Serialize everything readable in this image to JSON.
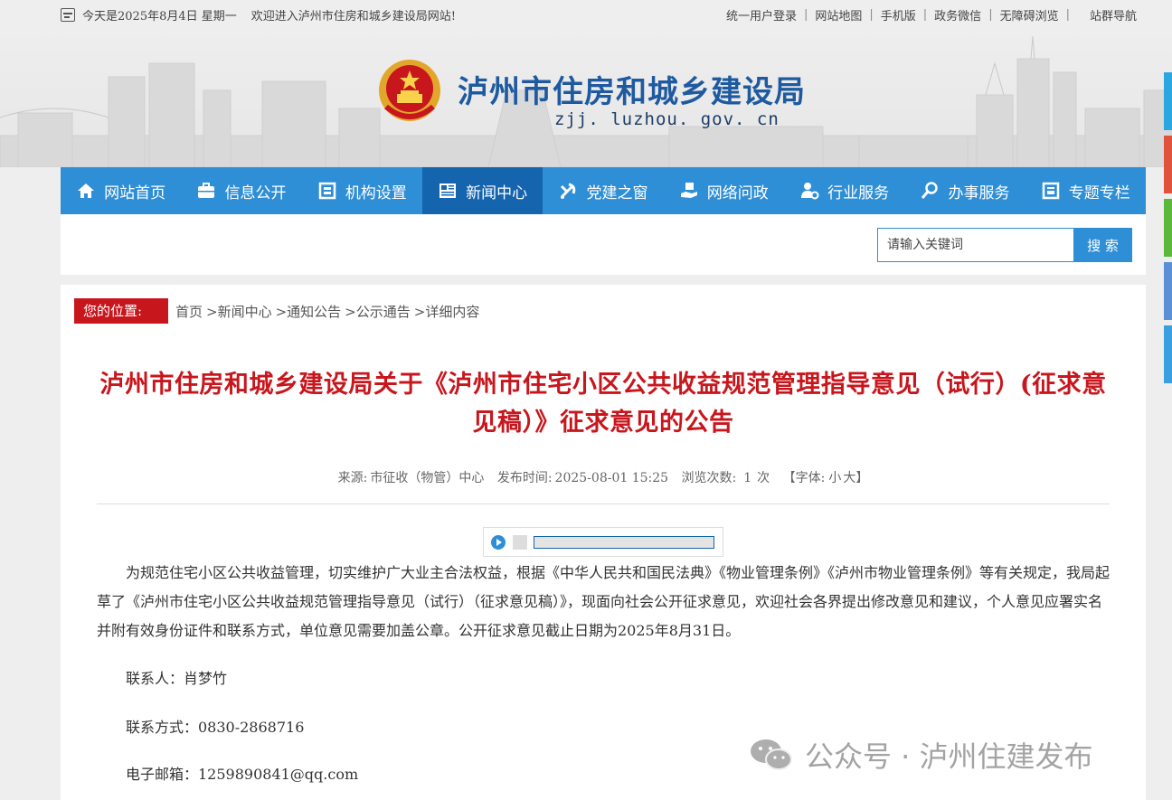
{
  "topbar": {
    "date_text": "今天是2025年8月4日 星期一",
    "welcome": "欢迎进入泸州市住房和城乡建设局网站!",
    "links": [
      "统一用户登录",
      "网站地图",
      "手机版",
      "政务微信",
      "无障碍浏览"
    ],
    "site_nav": "站群导航"
  },
  "header": {
    "title": "泸州市住房和城乡建设局",
    "domain": "zjj. luzhou. gov. cn",
    "emblem_icon": "national-emblem-icon"
  },
  "nav": {
    "items": [
      {
        "label": "网站首页",
        "icon": "home-icon"
      },
      {
        "label": "信息公开",
        "icon": "briefcase-icon"
      },
      {
        "label": "机构设置",
        "icon": "org-icon"
      },
      {
        "label": "新闻中心",
        "icon": "newspaper-icon"
      },
      {
        "label": "党建之窗",
        "icon": "party-icon"
      },
      {
        "label": "网络问政",
        "icon": "hand-icon"
      },
      {
        "label": "行业服务",
        "icon": "user-gear-icon"
      },
      {
        "label": "办事服务",
        "icon": "magnifier-icon"
      },
      {
        "label": "专题专栏",
        "icon": "column-icon"
      }
    ],
    "active_index": 3,
    "bg_color": "#2f8fd6",
    "active_color": "#1464ae"
  },
  "search": {
    "placeholder": "请输入关键词",
    "button_label": "搜 索"
  },
  "location": {
    "label": "您的位置:",
    "crumbs": [
      "首页",
      ">新闻中心",
      ">通知公告",
      ">公示通告",
      ">详细内容"
    ]
  },
  "article": {
    "title": "泸州市住房和城乡建设局关于《泸州市住宅小区公共收益规范管理指导意见（试行）(征求意见稿）》征求意见的公告",
    "meta": {
      "source_label": "来源:",
      "source": "市征收（物管）中心",
      "time_label": "发布时间:",
      "time": "2025-08-01 15:25",
      "views_label": "浏览次数:",
      "views": "1",
      "views_unit": "次",
      "font_label": "【字体:",
      "font_small": "小",
      "font_large": "大",
      "font_close": "】"
    },
    "audio_progress": 0,
    "paragraph": "为规范住宅小区公共收益管理，切实维护广大业主合法权益，根据《中华人民共和国民法典》《物业管理条例》《泸州市物业管理条例》等有关规定，我局起草了《泸州市住宅小区公共收益规范管理指导意见（试行）（征求意见稿）》，现面向社会公开征求意见，欢迎社会各界提出修改意见和建议，个人意见应署实名并附有效身份证件和联系方式，单位意见需要加盖公章。公开征求意见截止日期为2025年8月31日。",
    "contact_person": "联系人：肖梦竹",
    "contact_phone": "联系方式：0830-2868716",
    "contact_email": "电子邮箱：1259890841@qq.com"
  },
  "watermark": {
    "text": "公众号 · 泸州住建发布",
    "icon": "wechat-icon"
  },
  "side_tabs": [
    "#2aa7e0",
    "#e0523c",
    "#5bb83a",
    "#5b8fd6",
    "#3a9fe0"
  ],
  "colors": {
    "accent_red": "#c8161d",
    "brand_blue": "#2f8fd6"
  }
}
